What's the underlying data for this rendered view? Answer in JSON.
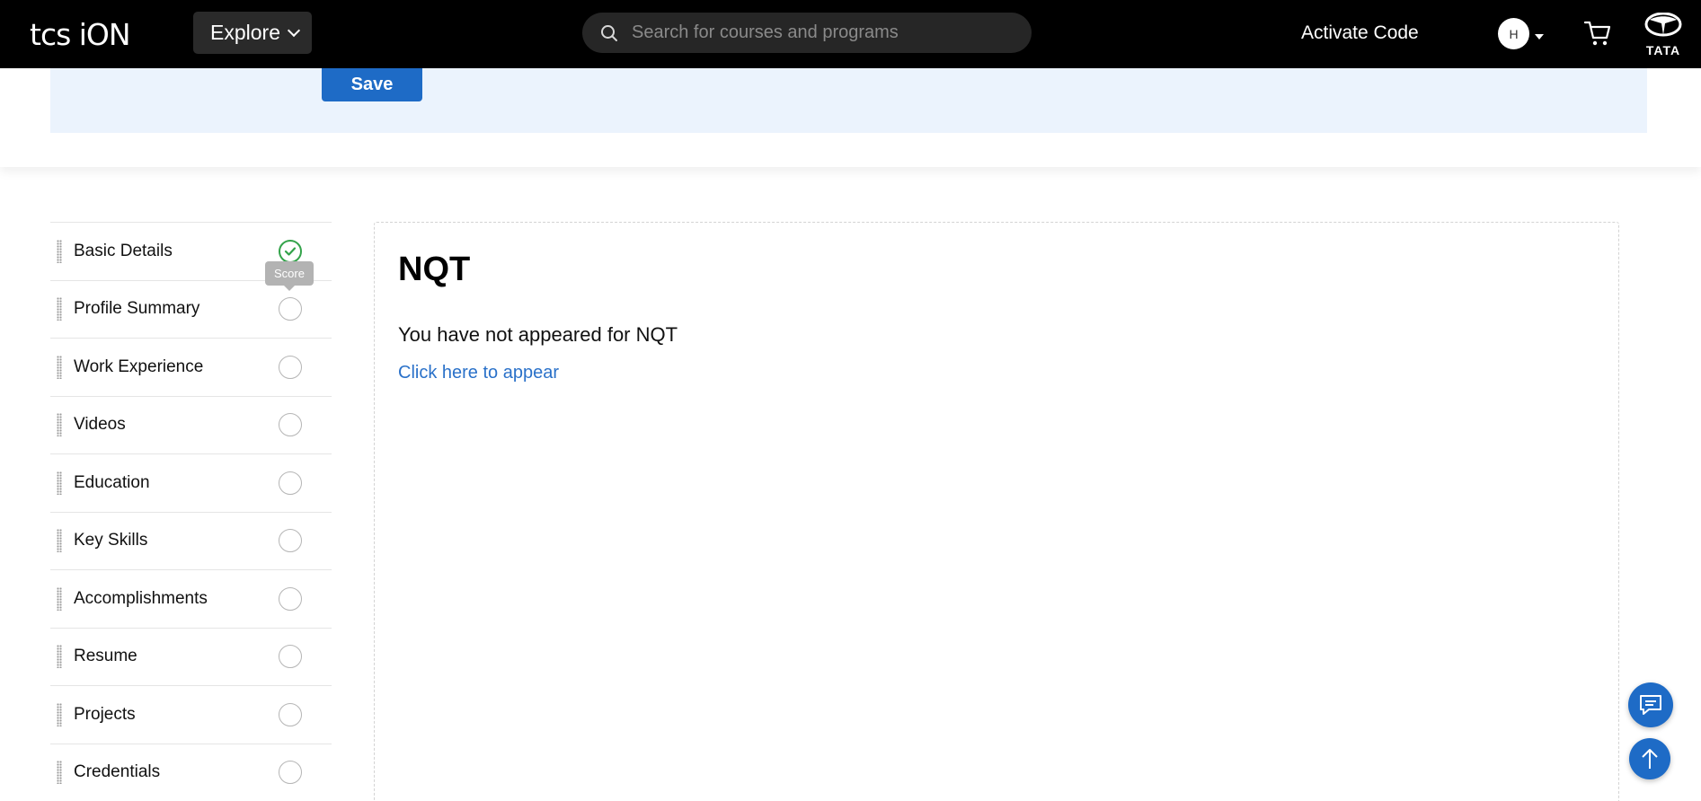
{
  "header": {
    "logo_text": "tcs iON",
    "explore_label": "Explore",
    "search_placeholder": "Search for courses and programs",
    "activate_label": "Activate Code",
    "avatar_initial": "H",
    "brand_word": "TATA"
  },
  "form": {
    "save_label": "Save"
  },
  "sidebar": {
    "tooltip": "Score",
    "items": [
      {
        "label": "Basic Details",
        "status": "complete"
      },
      {
        "label": "Profile Summary",
        "status": "pending"
      },
      {
        "label": "Work Experience",
        "status": "pending"
      },
      {
        "label": "Videos",
        "status": "pending"
      },
      {
        "label": "Education",
        "status": "pending"
      },
      {
        "label": "Key Skills",
        "status": "pending"
      },
      {
        "label": "Accomplishments",
        "status": "pending"
      },
      {
        "label": "Resume",
        "status": "pending"
      },
      {
        "label": "Projects",
        "status": "pending"
      },
      {
        "label": "Credentials",
        "status": "pending"
      }
    ]
  },
  "main": {
    "title": "NQT",
    "message": "You have not appeared for NQT",
    "link_label": "Click here to appear"
  },
  "floating": {
    "chat_icon": "chat-icon",
    "scroll_icon": "arrow-up-icon"
  },
  "colors": {
    "accent": "#1e6bc6",
    "complete": "#33a34a",
    "strip": "#ebf3fd",
    "topbar": "#000000"
  }
}
